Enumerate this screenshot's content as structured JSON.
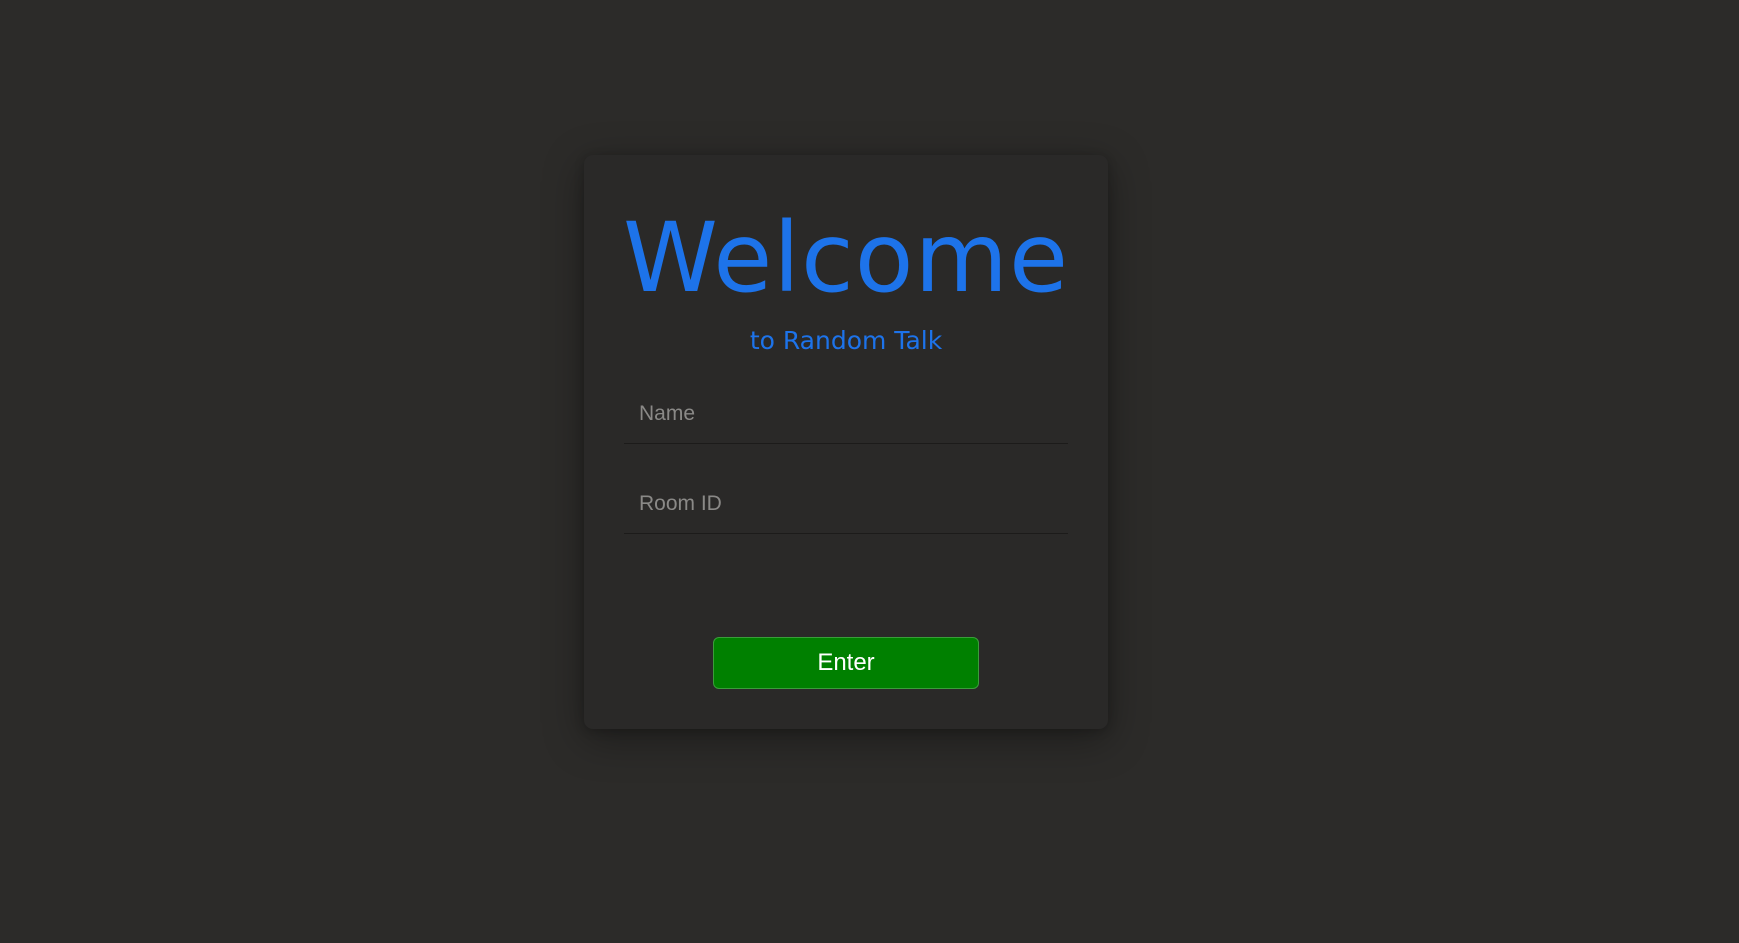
{
  "login": {
    "title": "Welcome",
    "subtitle": "to Random Talk",
    "name_placeholder": "Name",
    "name_value": "",
    "room_placeholder": "Room ID",
    "room_value": "",
    "enter_label": "Enter"
  },
  "colors": {
    "background": "#2c2b29",
    "card": "#2a2928",
    "accent": "#1d73ea",
    "button": "#008000",
    "placeholder": "#8a8987"
  }
}
